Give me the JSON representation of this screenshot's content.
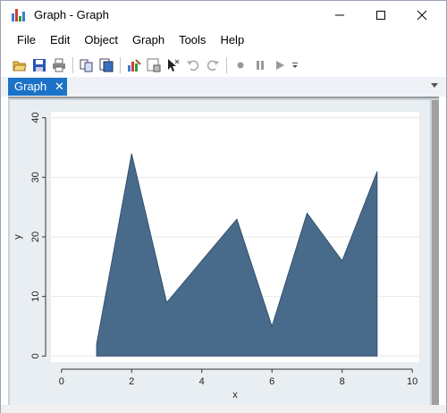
{
  "window": {
    "title": "Graph - Graph"
  },
  "menu": [
    "File",
    "Edit",
    "Object",
    "Graph",
    "Tools",
    "Help"
  ],
  "toolbar": {
    "icons": [
      "open-icon",
      "save-icon",
      "print-icon",
      "copy-icon",
      "copy-graph-icon",
      "graph-editor-icon",
      "data-editor-icon",
      "pointer-icon",
      "undo-icon",
      "redo-icon",
      "record-icon",
      "pause-icon",
      "play-icon"
    ]
  },
  "tabs": [
    {
      "label": "Graph",
      "close": "✕"
    }
  ],
  "colors": {
    "accent": "#1b73c8",
    "area_fill": "#486b8b",
    "plot_bg": "#ffffff",
    "graph_bg": "#e8eef1"
  },
  "chart_data": {
    "type": "area",
    "x": [
      1,
      2,
      3,
      4,
      5,
      6,
      7,
      8,
      9
    ],
    "y": [
      2,
      34,
      9,
      16,
      23,
      5,
      24,
      16,
      31
    ],
    "xlabel": "x",
    "ylabel": "y",
    "xlim": [
      -0.3,
      10.2
    ],
    "ylim": [
      -1,
      41
    ],
    "xticks": [
      0,
      2,
      4,
      6,
      8,
      10
    ],
    "yticks": [
      0,
      10,
      20,
      30,
      40
    ],
    "grid": true
  }
}
